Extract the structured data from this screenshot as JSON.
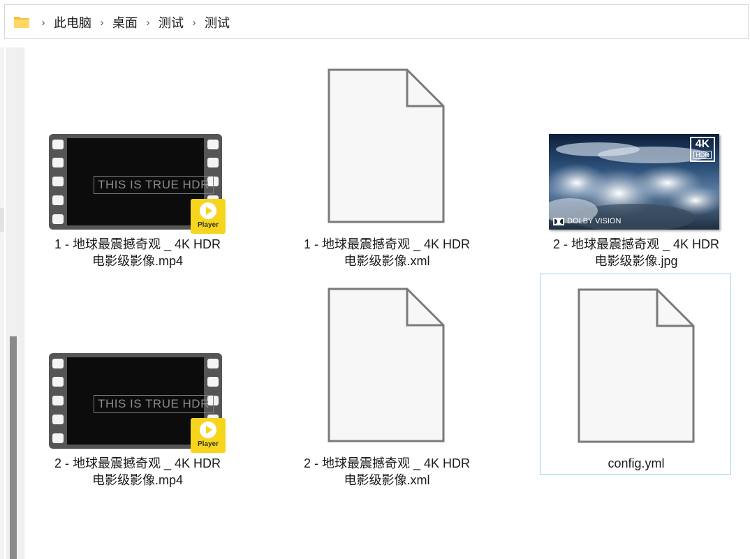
{
  "breadcrumb": {
    "items": [
      "此电脑",
      "桌面",
      "测试",
      "测试"
    ],
    "separator": "›"
  },
  "files": [
    {
      "name_line1": "1 - 地球最震撼奇观 _ 4K HDR",
      "name_line2": "电影级影像.mp4",
      "type": "video",
      "thumb_text": "THIS IS TRUE HDR",
      "badge": "Player"
    },
    {
      "name_line1": "1 - 地球最震撼奇观 _ 4K HDR",
      "name_line2": "电影级影像.xml",
      "type": "document"
    },
    {
      "name_line1": "2 - 地球最震撼奇观 _ 4K HDR",
      "name_line2": "电影级影像.jpg",
      "type": "image",
      "thumb_badge_top": "4K",
      "thumb_badge_bottom": "HDR",
      "thumb_brand": "DOLBY VISION"
    },
    {
      "name_line1": "2 - 地球最震撼奇观 _ 4K HDR",
      "name_line2": "电影级影像.mp4",
      "type": "video",
      "thumb_text": "THIS IS TRUE HDR",
      "badge": "Player"
    },
    {
      "name_line1": "2 - 地球最震撼奇观 _ 4K HDR",
      "name_line2": "电影级影像.xml",
      "type": "document"
    },
    {
      "name_line1": "config.yml",
      "name_line2": "",
      "type": "document",
      "selected": true
    }
  ],
  "colors": {
    "selection_border": "#99d1f5",
    "player_badge": "#f7d51d",
    "folder_icon": "#f5c242"
  }
}
